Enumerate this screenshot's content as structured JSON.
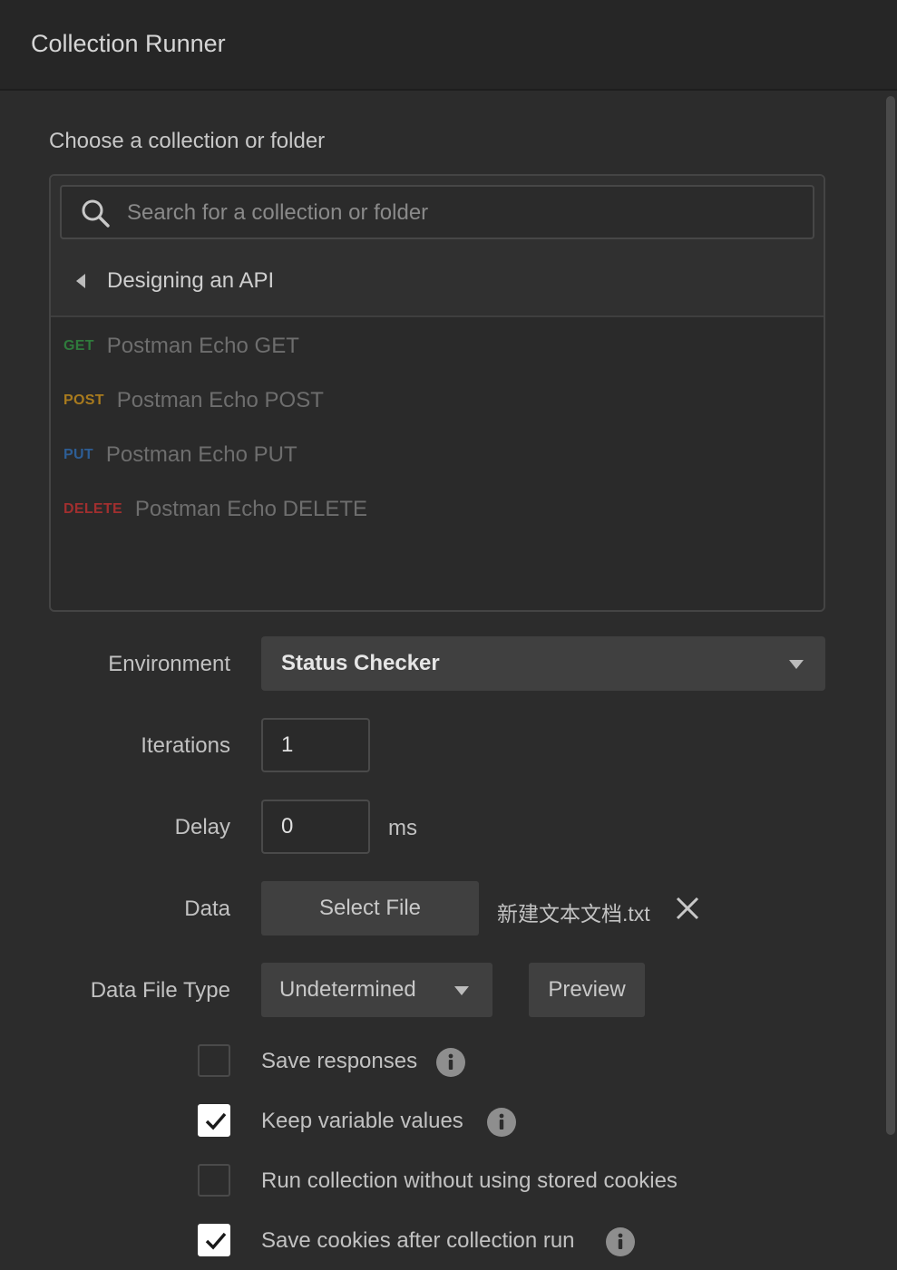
{
  "header": {
    "title": "Collection Runner"
  },
  "picker": {
    "label": "Choose a collection or folder",
    "search_placeholder": "Search for a collection or folder",
    "breadcrumb": "Designing an API",
    "requests": [
      {
        "method": "GET",
        "name": "Postman Echo GET",
        "color": "#2f7a3c"
      },
      {
        "method": "POST",
        "name": "Postman Echo POST",
        "color": "#a97b1e"
      },
      {
        "method": "PUT",
        "name": "Postman Echo PUT",
        "color": "#2d5d94"
      },
      {
        "method": "DELETE",
        "name": "Postman Echo DELETE",
        "color": "#a12f2f"
      }
    ]
  },
  "form": {
    "environment": {
      "label": "Environment",
      "value": "Status Checker"
    },
    "iterations": {
      "label": "Iterations",
      "value": "1"
    },
    "delay": {
      "label": "Delay",
      "value": "0",
      "unit": "ms"
    },
    "data": {
      "label": "Data",
      "button": "Select File",
      "file_name": "新建文本文档.txt"
    },
    "data_file_type": {
      "label": "Data File Type",
      "value": "Undetermined",
      "preview": "Preview"
    }
  },
  "options": [
    {
      "label": "Save responses",
      "checked": false,
      "info": true
    },
    {
      "label": "Keep variable values",
      "checked": true,
      "info": true
    },
    {
      "label": "Run collection without using stored cookies",
      "checked": false,
      "info": false
    },
    {
      "label": "Save cookies after collection run",
      "checked": true,
      "info": true
    }
  ]
}
